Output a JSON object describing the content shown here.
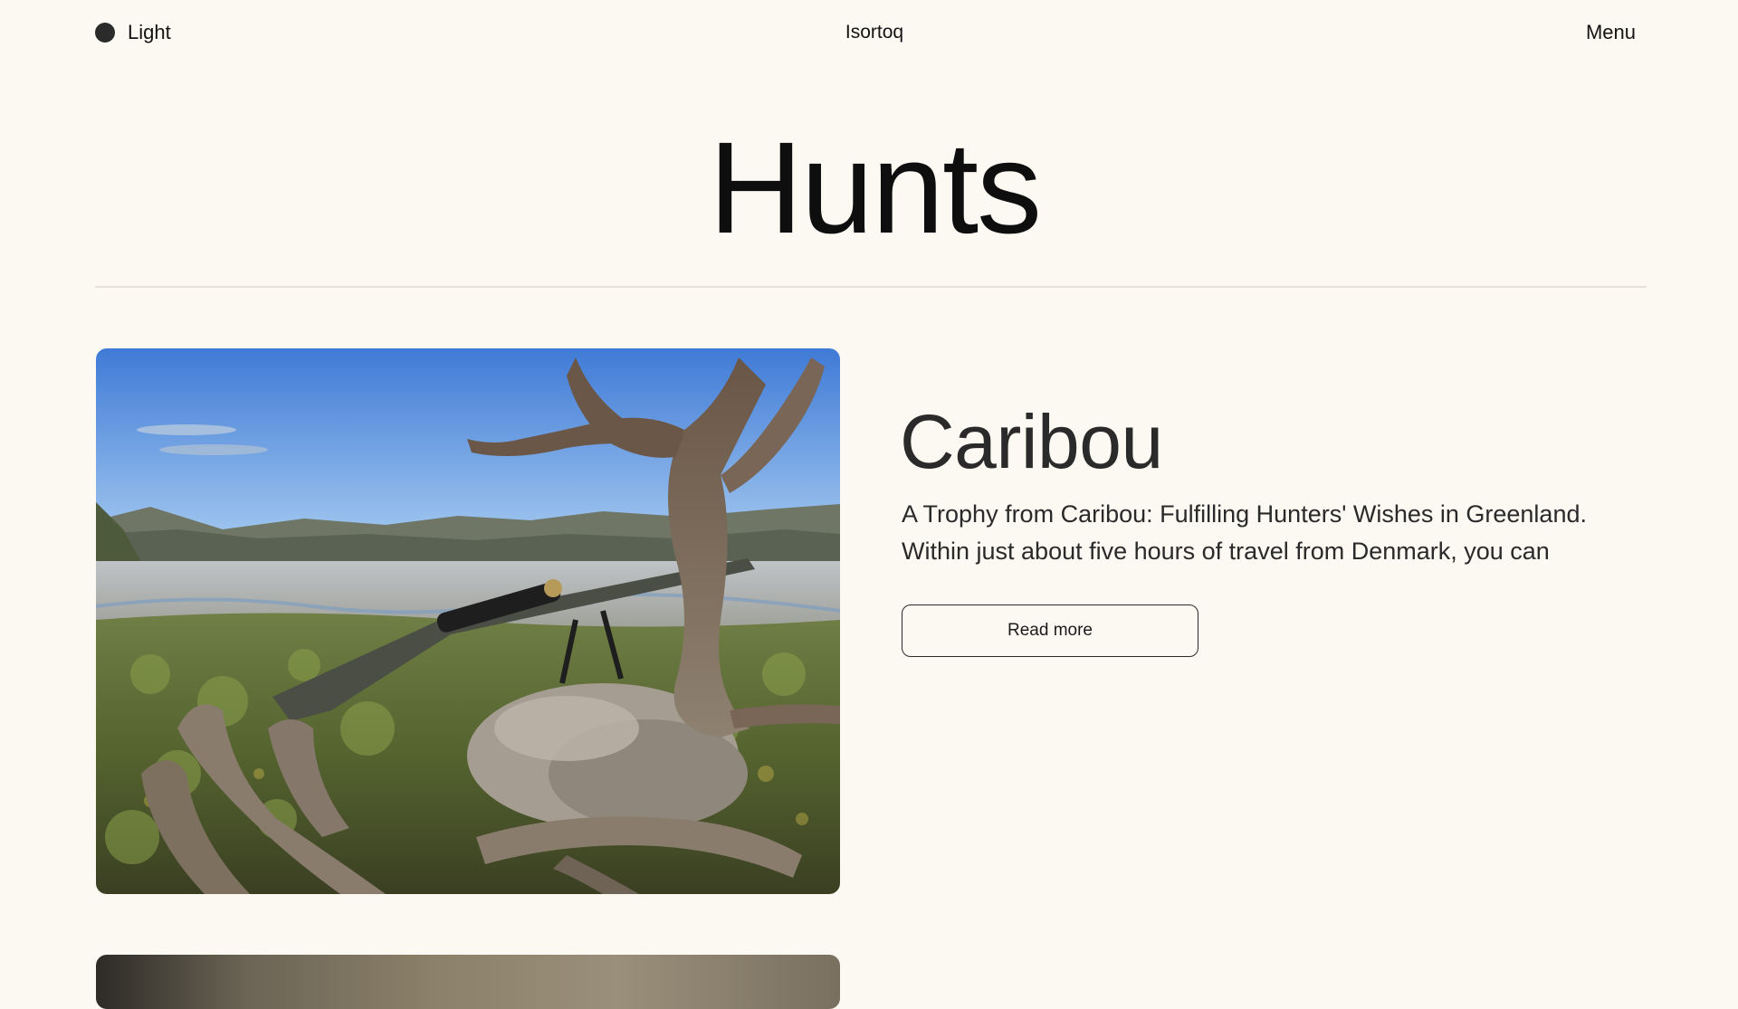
{
  "header": {
    "theme_label": "Light",
    "site_name": "Isortoq",
    "menu_label": "Menu"
  },
  "page": {
    "title": "Hunts"
  },
  "cards": [
    {
      "title": "Caribou",
      "excerpt": "A Trophy from Caribou: Fulfilling Hunters' Wishes in Greenland. Within just about five hours of travel from Denmark, you can",
      "button_label": "Read more",
      "image_alt": "Caribou lying in tundra with antlers and a scoped rifle, mountains and a river delta behind under blue sky"
    }
  ],
  "colors": {
    "background": "#fcf9f3",
    "text": "#141414",
    "divider": "#e8e3da"
  }
}
